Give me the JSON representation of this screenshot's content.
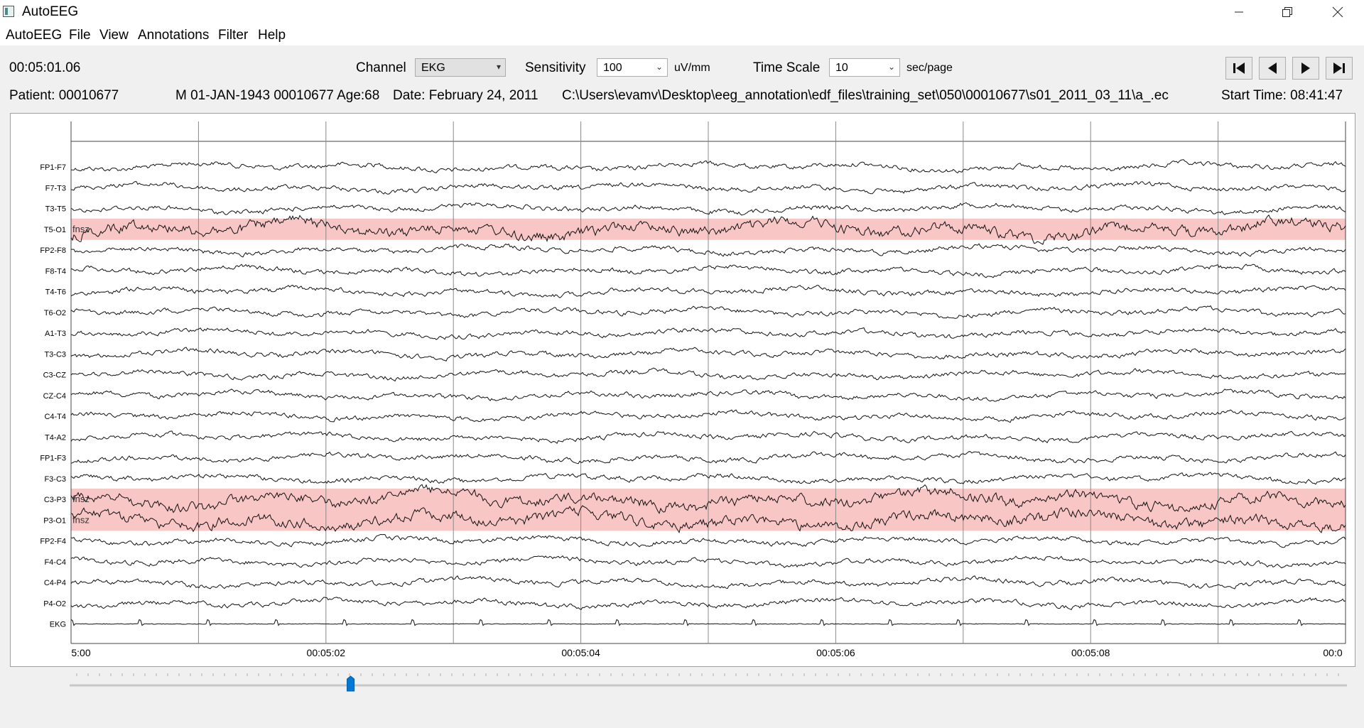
{
  "window": {
    "title": "AutoEEG",
    "minimize_icon": "minimize-icon",
    "restore_icon": "restore-icon",
    "close_icon": "close-icon"
  },
  "menu": [
    "AutoEEG",
    "File",
    "View",
    "Annotations",
    "Filter",
    "Help"
  ],
  "toolbar": {
    "current_time": "00:05:01.06",
    "channel_label": "Channel",
    "channel_value": "EKG",
    "sensitivity_label": "Sensitivity",
    "sensitivity_value": "100",
    "sensitivity_unit": "uV/mm",
    "timescale_label": "Time Scale",
    "timescale_value": "10",
    "timescale_unit": "sec/page",
    "nav_icons": [
      "skip-to-start-icon",
      "step-back-icon",
      "step-forward-icon",
      "skip-to-end-icon"
    ]
  },
  "patient": {
    "id": "Patient: 00010677",
    "info": "M 01-JAN-1943 00010677 Age:68",
    "date": "Date: February 24, 2011",
    "path": "C:\\Users\\evamv\\Desktop\\eeg_annotation\\edf_files\\training_set\\050\\00010677\\s01_2011_03_11\\a_.ec",
    "start_time": "Start Time: 08:41:47"
  },
  "plot": {
    "channels": [
      "FP1-F7",
      "F7-T3",
      "T3-T5",
      "T5-O1",
      "FP2-F8",
      "F8-T4",
      "T4-T6",
      "T6-O2",
      "A1-T3",
      "T3-C3",
      "C3-CZ",
      "CZ-C4",
      "C4-T4",
      "T4-A2",
      "FP1-F3",
      "F3-C3",
      "C3-P3",
      "P3-O1",
      "FP2-F4",
      "F4-C4",
      "C4-P4",
      "P4-O2",
      "EKG"
    ],
    "time_labels": [
      "5:00",
      "00:05:02",
      "00:05:04",
      "00:05:06",
      "00:05:08",
      "00:0"
    ],
    "annotations": [
      {
        "channel": "T5-O1",
        "label": "fnsz"
      },
      {
        "channel": "C3-P3",
        "label": "fnsz"
      },
      {
        "channel": "P3-O1",
        "label": "fnsz"
      }
    ],
    "annotation_color": "#f9c6c6"
  },
  "slider": {
    "value": 0.22
  }
}
